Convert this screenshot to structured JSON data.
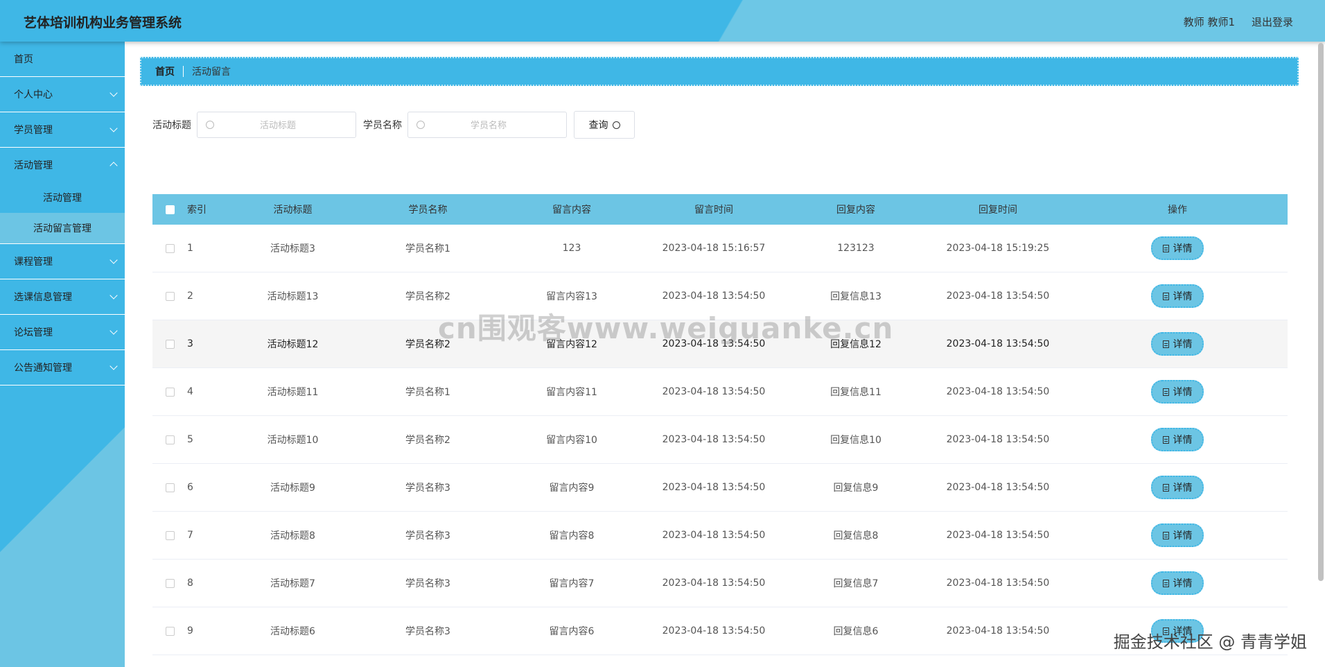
{
  "header": {
    "title": "艺体培训机构业务管理系统",
    "user": "教师 教师1",
    "logout": "退出登录"
  },
  "sidebar": {
    "items": [
      {
        "label": "首页"
      },
      {
        "label": "个人中心"
      },
      {
        "label": "学员管理"
      },
      {
        "label": "活动管理"
      },
      {
        "label": "课程管理"
      },
      {
        "label": "选课信息管理"
      },
      {
        "label": "论坛管理"
      },
      {
        "label": "公告通知管理"
      }
    ],
    "sub_items": [
      {
        "label": "活动管理"
      },
      {
        "label": "活动留言管理"
      }
    ]
  },
  "breadcrumb": {
    "home": "首页",
    "current": "活动留言"
  },
  "search": {
    "title_label": "活动标题",
    "title_placeholder": "活动标题",
    "student_label": "学员名称",
    "student_placeholder": "学员名称",
    "query_button": "查询"
  },
  "table": {
    "headers": [
      "索引",
      "活动标题",
      "学员名称",
      "留言内容",
      "留言时间",
      "回复内容",
      "回复时间",
      "操作"
    ],
    "detail_label": "详情",
    "rows": [
      {
        "idx": "1",
        "title": "活动标题3",
        "student": "学员名称1",
        "message": "123",
        "msg_time": "2023-04-18 15:16:57",
        "reply": "123123",
        "reply_time": "2023-04-18 15:19:25"
      },
      {
        "idx": "2",
        "title": "活动标题13",
        "student": "学员名称2",
        "message": "留言内容13",
        "msg_time": "2023-04-18 13:54:50",
        "reply": "回复信息13",
        "reply_time": "2023-04-18 13:54:50"
      },
      {
        "idx": "3",
        "title": "活动标题12",
        "student": "学员名称2",
        "message": "留言内容12",
        "msg_time": "2023-04-18 13:54:50",
        "reply": "回复信息12",
        "reply_time": "2023-04-18 13:54:50"
      },
      {
        "idx": "4",
        "title": "活动标题11",
        "student": "学员名称1",
        "message": "留言内容11",
        "msg_time": "2023-04-18 13:54:50",
        "reply": "回复信息11",
        "reply_time": "2023-04-18 13:54:50"
      },
      {
        "idx": "5",
        "title": "活动标题10",
        "student": "学员名称2",
        "message": "留言内容10",
        "msg_time": "2023-04-18 13:54:50",
        "reply": "回复信息10",
        "reply_time": "2023-04-18 13:54:50"
      },
      {
        "idx": "6",
        "title": "活动标题9",
        "student": "学员名称3",
        "message": "留言内容9",
        "msg_time": "2023-04-18 13:54:50",
        "reply": "回复信息9",
        "reply_time": "2023-04-18 13:54:50"
      },
      {
        "idx": "7",
        "title": "活动标题8",
        "student": "学员名称3",
        "message": "留言内容8",
        "msg_time": "2023-04-18 13:54:50",
        "reply": "回复信息8",
        "reply_time": "2023-04-18 13:54:50"
      },
      {
        "idx": "8",
        "title": "活动标题7",
        "student": "学员名称3",
        "message": "留言内容7",
        "msg_time": "2023-04-18 13:54:50",
        "reply": "回复信息7",
        "reply_time": "2023-04-18 13:54:50"
      },
      {
        "idx": "9",
        "title": "活动标题6",
        "student": "学员名称3",
        "message": "留言内容6",
        "msg_time": "2023-04-18 13:54:50",
        "reply": "回复信息6",
        "reply_time": "2023-04-18 13:54:50"
      }
    ]
  },
  "watermarks": {
    "center": "cn围观客www.weiguanke.cn",
    "corner": "掘金技术社区 @ 青青学姐"
  },
  "colors": {
    "primary": "#3fb7e6",
    "light": "#6cc5e4"
  }
}
